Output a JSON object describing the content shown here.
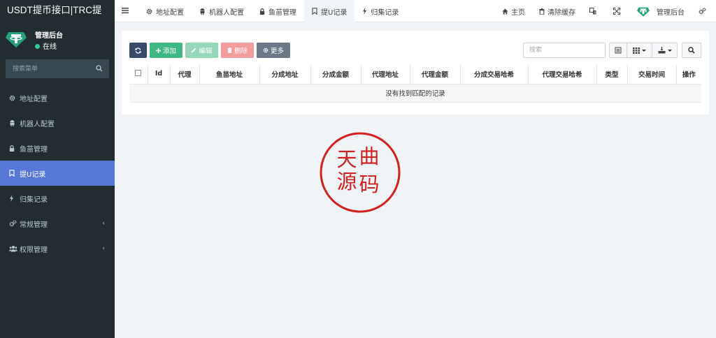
{
  "app": {
    "title": "USDT提币接口|TRC提"
  },
  "user": {
    "name": "管理后台",
    "status": "在线"
  },
  "sidebar": {
    "search_placeholder": "搜索菜单",
    "items": [
      {
        "label": "地址配置",
        "icon": "gear-icon"
      },
      {
        "label": "机器人配置",
        "icon": "android-icon"
      },
      {
        "label": "鱼苗管理",
        "icon": "lock-icon"
      },
      {
        "label": "提U记录",
        "icon": "bookmark-icon",
        "active": true
      },
      {
        "label": "归集记录",
        "icon": "bolt-icon"
      },
      {
        "label": "常规管理",
        "icon": "cogs-icon",
        "has_children": true
      },
      {
        "label": "权限管理",
        "icon": "users-icon",
        "has_children": true
      }
    ]
  },
  "topbar": {
    "tabs": [
      {
        "label": "地址配置",
        "icon": "gear-icon"
      },
      {
        "label": "机器人配置",
        "icon": "android-icon"
      },
      {
        "label": "鱼苗管理",
        "icon": "lock-icon"
      },
      {
        "label": "提U记录",
        "icon": "bookmark-icon",
        "active": true
      },
      {
        "label": "归集记录",
        "icon": "bolt-icon"
      }
    ],
    "home": "主页",
    "clear_cache": "清除缓存",
    "admin": "管理后台"
  },
  "toolbar": {
    "add": "添加",
    "edit": "编辑",
    "delete": "删除",
    "more": "更多",
    "search_placeholder": "搜索"
  },
  "table": {
    "columns": [
      "Id",
      "代理",
      "鱼苗地址",
      "分成地址",
      "分成金额",
      "代理地址",
      "代理金额",
      "分成交易哈希",
      "代理交易哈希",
      "类型",
      "交易时间",
      "操作"
    ],
    "empty_text": "没有找到匹配的记录"
  },
  "watermark": {
    "text": "天曲源码"
  },
  "colors": {
    "sidebar_bg": "#222d32",
    "active": "#5777d5",
    "add": "#40b883",
    "edit": "#94d7b9",
    "delete": "#f19d9d",
    "more": "#6b7888",
    "refresh": "#3b4a6b",
    "seal": "#d32020"
  }
}
